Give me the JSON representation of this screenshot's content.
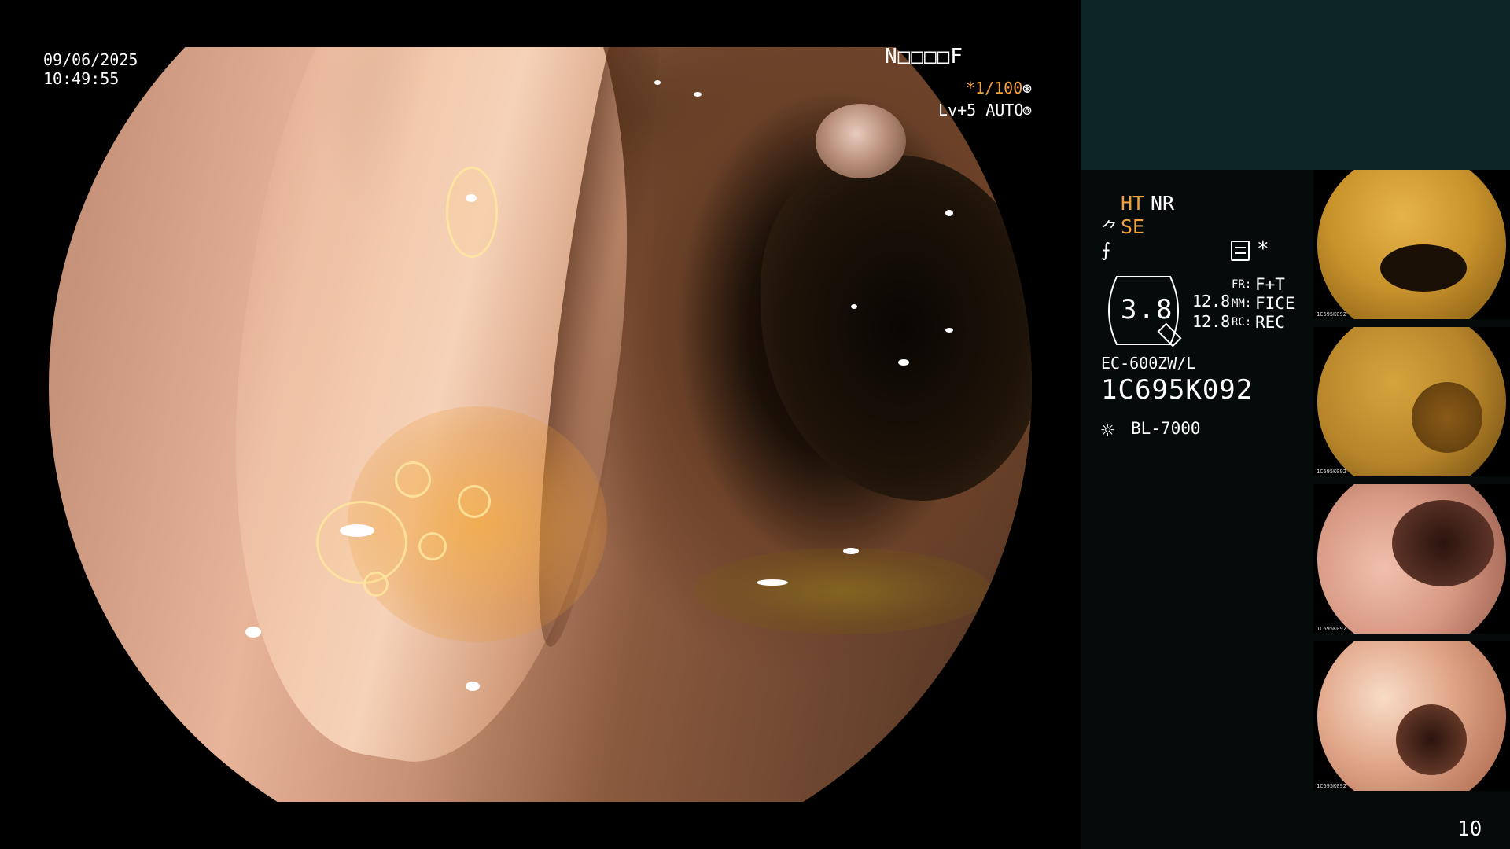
{
  "osd": {
    "date": "09/06/2025",
    "time": "10:49:55",
    "patient_id": "N□□□□F",
    "shutter": "*1/100",
    "shutter_icon": "⊛",
    "iris": "Lv+5 AUTO",
    "iris_icon": "⊚"
  },
  "info": {
    "ht": "HT",
    "nr": "NR",
    "se_icon": "⺈",
    "se": "SE",
    "enhance_icon": "⨍",
    "star": "*",
    "zoom_value": "3.8",
    "zoom_a": "12.8",
    "zoom_b": "12.8",
    "fr_label": "FR:",
    "fr_value": "F+T",
    "mm_label": "MM:",
    "mm_value": "FICE",
    "rc_label": "RC:",
    "rc_value": "REC",
    "scope_model": "EC-600ZW/L",
    "scope_serial": "1C695K092",
    "light_icon": "☼",
    "light_source": "BL-7000"
  },
  "thumbnails": [
    {
      "meta": "1C695K092"
    },
    {
      "meta": "1C695K092"
    },
    {
      "meta": "1C695K092"
    },
    {
      "meta": "1C695K092"
    }
  ],
  "page_number": "10",
  "colors": {
    "accent_orange": "#f1a23c",
    "panel_header": "#0e2525",
    "panel_body": "#050b0b"
  }
}
